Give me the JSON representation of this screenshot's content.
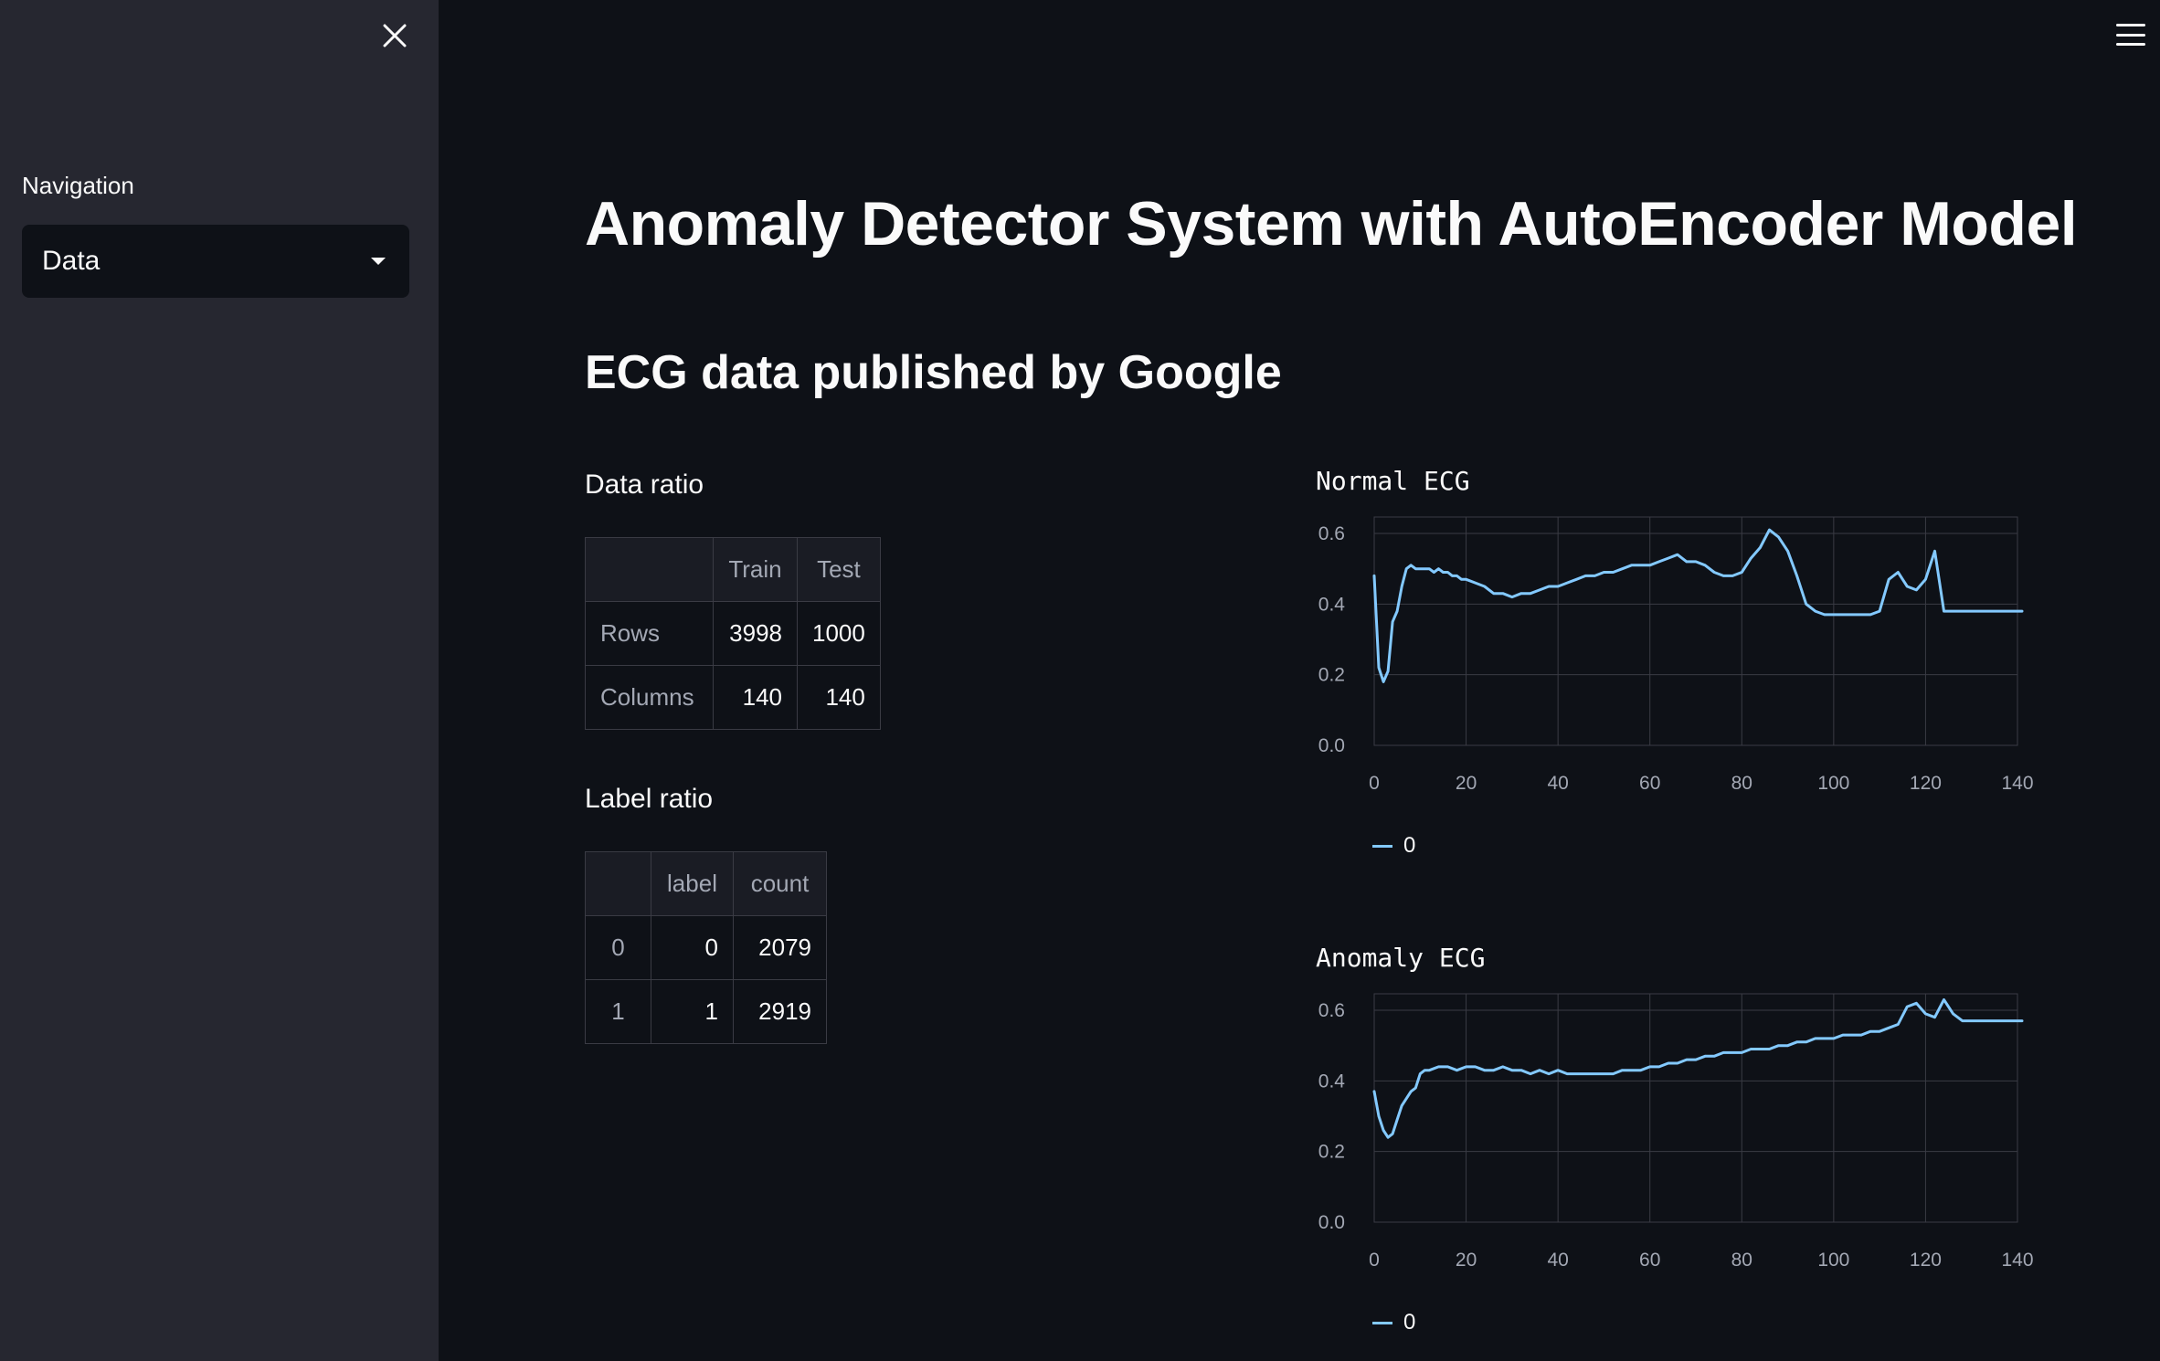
{
  "sidebar": {
    "nav_label": "Navigation",
    "nav_value": "Data"
  },
  "main": {
    "title": "Anomaly Detector System with AutoEncoder Model",
    "subtitle": "ECG data published by Google",
    "data_ratio": {
      "label": "Data ratio",
      "columns": [
        "",
        "Train",
        "Test"
      ],
      "rows": [
        {
          "name": "Rows",
          "train": "3998",
          "test": "1000"
        },
        {
          "name": "Columns",
          "train": "140",
          "test": "140"
        }
      ]
    },
    "label_ratio": {
      "label": "Label ratio",
      "columns": [
        "",
        "label",
        "count"
      ],
      "rows": [
        {
          "index": "0",
          "label": "0",
          "count": "2079"
        },
        {
          "index": "1",
          "label": "1",
          "count": "2919"
        }
      ]
    }
  },
  "colors": {
    "background": "#0e1117",
    "sidebar": "#262730",
    "line": "#83c9ff",
    "grid": "#3a3b44"
  },
  "chart_data": [
    {
      "type": "line",
      "title": "Normal ECG",
      "legend": [
        "0"
      ],
      "xlim": [
        0,
        140
      ],
      "ylim": [
        0,
        0.6
      ],
      "xticks": [
        "0",
        "20",
        "40",
        "60",
        "80",
        "100",
        "120",
        "140"
      ],
      "yticks": [
        "0.0",
        "0.2",
        "0.4",
        "0.6"
      ],
      "grid": true,
      "series": [
        {
          "name": "0",
          "x": [
            0,
            1,
            2,
            3,
            4,
            5,
            6,
            7,
            8,
            9,
            10,
            11,
            12,
            13,
            14,
            15,
            16,
            17,
            18,
            19,
            20,
            22,
            24,
            26,
            28,
            30,
            32,
            34,
            36,
            38,
            40,
            42,
            44,
            46,
            48,
            50,
            52,
            54,
            56,
            58,
            60,
            62,
            64,
            66,
            68,
            70,
            72,
            74,
            76,
            78,
            80,
            82,
            84,
            86,
            88,
            90,
            92,
            94,
            96,
            98,
            100,
            101,
            102,
            104,
            106,
            108,
            110,
            112,
            114,
            116,
            118,
            120,
            122,
            124,
            126,
            128,
            130,
            132,
            134,
            135,
            136,
            137,
            138,
            139,
            140,
            141
          ],
          "y": [
            0.48,
            0.22,
            0.18,
            0.21,
            0.35,
            0.38,
            0.45,
            0.5,
            0.51,
            0.5,
            0.5,
            0.5,
            0.5,
            0.49,
            0.5,
            0.49,
            0.49,
            0.48,
            0.48,
            0.47,
            0.47,
            0.46,
            0.45,
            0.43,
            0.43,
            0.42,
            0.43,
            0.43,
            0.44,
            0.45,
            0.45,
            0.46,
            0.47,
            0.48,
            0.48,
            0.49,
            0.49,
            0.5,
            0.51,
            0.51,
            0.51,
            0.52,
            0.53,
            0.54,
            0.52,
            0.52,
            0.51,
            0.49,
            0.48,
            0.48,
            0.49,
            0.53,
            0.56,
            0.61,
            0.59,
            0.55,
            0.48,
            0.4,
            0.38,
            0.37,
            0.37,
            0.37,
            0.37,
            0.37,
            0.37,
            0.37,
            0.38,
            0.47,
            0.49,
            0.45,
            0.44,
            0.47,
            0.55,
            0.38,
            0.38,
            0.38,
            0.38,
            0.38,
            0.38,
            0.38,
            0.38,
            0.38,
            0.38,
            0.38,
            0.38,
            0.38
          ]
        }
      ]
    },
    {
      "type": "line",
      "title": "Anomaly ECG",
      "legend": [
        "0"
      ],
      "xlim": [
        0,
        140
      ],
      "ylim": [
        0,
        0.6
      ],
      "xticks": [
        "0",
        "20",
        "40",
        "60",
        "80",
        "100",
        "120",
        "140"
      ],
      "yticks": [
        "0.0",
        "0.2",
        "0.4",
        "0.6"
      ],
      "grid": true,
      "series": [
        {
          "name": "0",
          "x": [
            0,
            1,
            2,
            3,
            4,
            5,
            6,
            7,
            8,
            9,
            10,
            11,
            12,
            14,
            16,
            18,
            20,
            22,
            24,
            26,
            28,
            30,
            32,
            34,
            36,
            38,
            40,
            42,
            44,
            46,
            48,
            50,
            52,
            54,
            56,
            58,
            60,
            62,
            64,
            66,
            68,
            70,
            72,
            74,
            76,
            78,
            80,
            82,
            84,
            86,
            88,
            90,
            92,
            94,
            96,
            98,
            100,
            102,
            104,
            106,
            108,
            110,
            112,
            114,
            116,
            118,
            120,
            122,
            124,
            126,
            128,
            130,
            132,
            134,
            136,
            137,
            138,
            139,
            140,
            141
          ],
          "y": [
            0.37,
            0.3,
            0.26,
            0.24,
            0.25,
            0.29,
            0.33,
            0.35,
            0.37,
            0.38,
            0.42,
            0.43,
            0.43,
            0.44,
            0.44,
            0.43,
            0.44,
            0.44,
            0.43,
            0.43,
            0.44,
            0.43,
            0.43,
            0.42,
            0.43,
            0.42,
            0.43,
            0.42,
            0.42,
            0.42,
            0.42,
            0.42,
            0.42,
            0.43,
            0.43,
            0.43,
            0.44,
            0.44,
            0.45,
            0.45,
            0.46,
            0.46,
            0.47,
            0.47,
            0.48,
            0.48,
            0.48,
            0.49,
            0.49,
            0.49,
            0.5,
            0.5,
            0.51,
            0.51,
            0.52,
            0.52,
            0.52,
            0.53,
            0.53,
            0.53,
            0.54,
            0.54,
            0.55,
            0.56,
            0.61,
            0.62,
            0.59,
            0.58,
            0.63,
            0.59,
            0.57,
            0.57,
            0.57,
            0.57,
            0.57,
            0.57,
            0.57,
            0.57,
            0.57,
            0.57
          ]
        }
      ]
    }
  ]
}
